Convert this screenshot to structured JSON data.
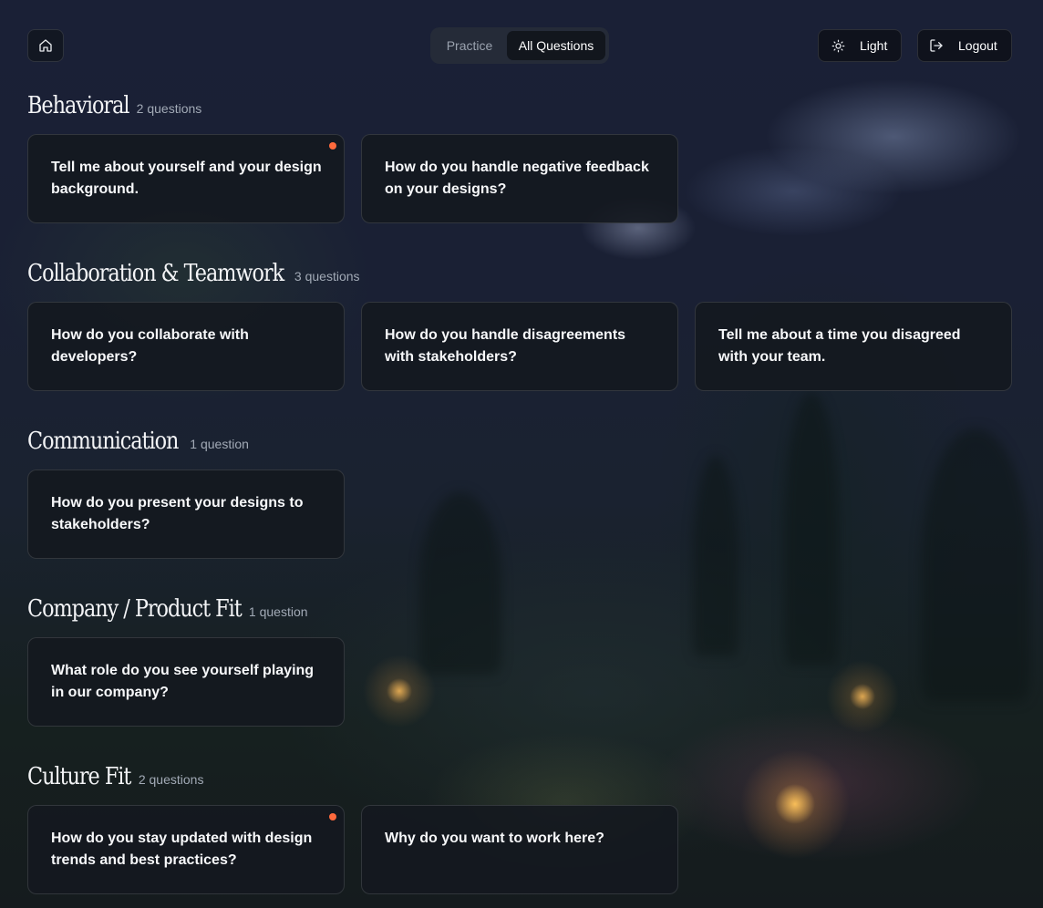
{
  "header": {
    "home_icon": "home-icon",
    "tabs": [
      {
        "label": "Practice",
        "active": false
      },
      {
        "label": "All Questions",
        "active": true
      }
    ],
    "theme_button": {
      "label": "Light",
      "icon": "sun-icon"
    },
    "logout_button": {
      "label": "Logout",
      "icon": "logout-icon"
    }
  },
  "sections": [
    {
      "title": "Behavioral",
      "count": "2 questions",
      "questions": [
        {
          "text": "Tell me about yourself and your design background.",
          "new": true
        },
        {
          "text": "How do you handle negative feedback on your designs?",
          "new": false
        }
      ]
    },
    {
      "title": "Collaboration & Teamwork",
      "count": "3 questions",
      "questions": [
        {
          "text": "How do you collaborate with developers?",
          "new": false
        },
        {
          "text": "How do you handle disagreements with stakeholders?",
          "new": false
        },
        {
          "text": "Tell me about a time you disagreed with your team.",
          "new": false
        }
      ]
    },
    {
      "title": "Communication",
      "count": "1 question",
      "questions": [
        {
          "text": "How do you present your designs to stakeholders?",
          "new": false
        }
      ]
    },
    {
      "title": "Company / Product Fit",
      "count": "1 question",
      "questions": [
        {
          "text": "What role do you see yourself playing in our company?",
          "new": false
        }
      ]
    },
    {
      "title": "Culture Fit",
      "count": "2 questions",
      "questions": [
        {
          "text": "How do you stay updated with design trends and best practices?",
          "new": true
        },
        {
          "text": "Why do you want to work here?",
          "new": false
        }
      ]
    }
  ],
  "colors": {
    "accent_dot": "#ff6a3d",
    "card_bg": "#14181f",
    "muted_text": "#a2aab6"
  }
}
